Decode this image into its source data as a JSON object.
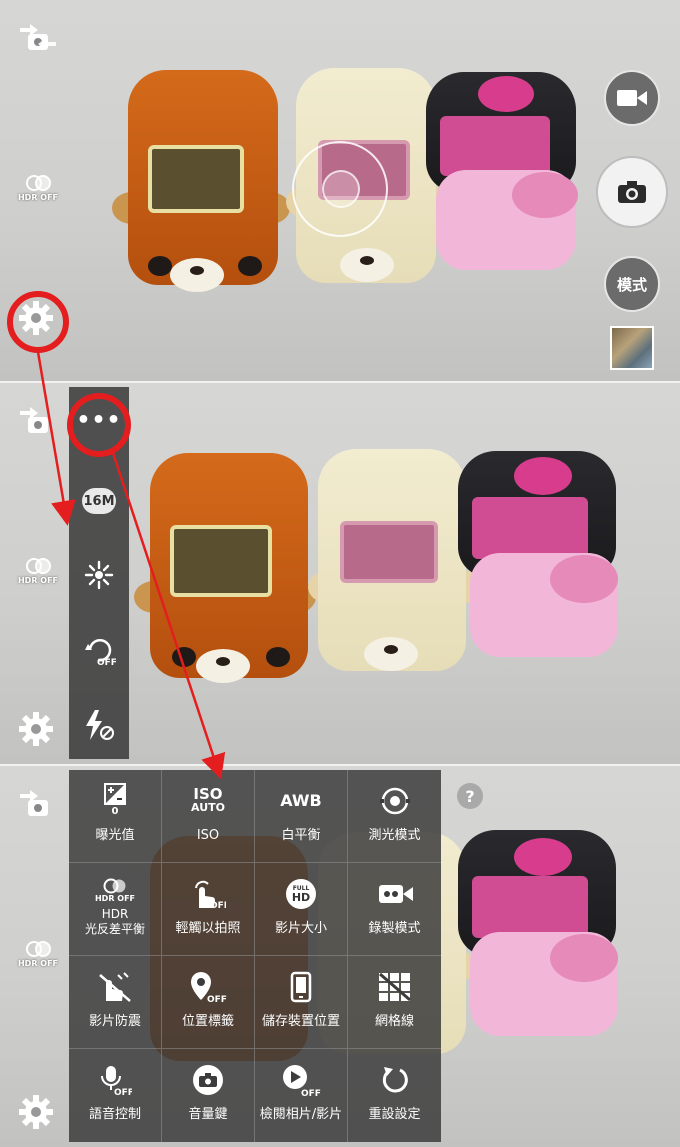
{
  "camera": {
    "hdr_label": "HDR OFF",
    "mode_label": "模式",
    "resolution_badge": "16M",
    "more_label": "•••"
  },
  "settings": {
    "exposure": {
      "value": "0",
      "label": "曝光值"
    },
    "iso": {
      "icon_top": "ISO",
      "icon_bottom": "AUTO",
      "label": "ISO"
    },
    "white_balance": {
      "icon": "AWB",
      "label": "白平衡"
    },
    "metering": {
      "label": "測光模式"
    },
    "hdr": {
      "icon_label": "HDR OFF",
      "label_line1": "HDR",
      "label_line2": "光反差平衡"
    },
    "tap_to_shoot": {
      "label": "輕觸以拍照",
      "state": "OFF"
    },
    "video_size": {
      "icon_top": "FULL",
      "icon_bottom": "HD",
      "label": "影片大小"
    },
    "recording_mode": {
      "label": "錄製模式"
    },
    "video_stabilization": {
      "label": "影片防震"
    },
    "location_tag": {
      "label": "位置標籤",
      "state": "OFF"
    },
    "storage": {
      "label": "儲存裝置位置"
    },
    "grid_lines": {
      "label": "網格線"
    },
    "voice_control": {
      "label": "語音控制",
      "state": "OFF"
    },
    "volume_key": {
      "label": "音量鍵"
    },
    "review": {
      "label": "檢閱相片/影片",
      "state": "OFF"
    },
    "reset": {
      "label": "重設設定"
    },
    "help": "?"
  },
  "colors": {
    "annotation_red": "#e41e1e",
    "panel_gray": "#3c3c3c"
  }
}
